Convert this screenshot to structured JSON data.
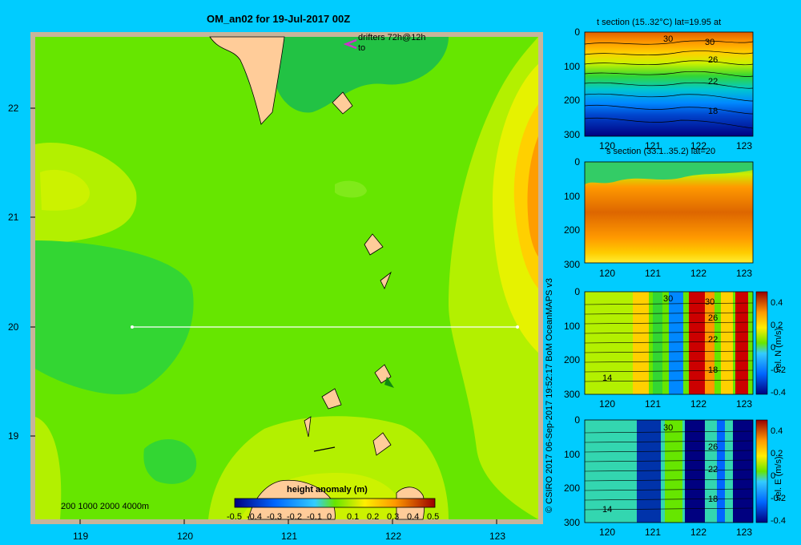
{
  "main": {
    "title": "OM_an02 for 19-Jul-2017 00Z",
    "drifters_label": "drifters 72h@12h",
    "drifters_sub": "to",
    "depth_legend": "200  1000  2000  4000m",
    "lat_ticks": [
      "22",
      "21",
      "20",
      "19"
    ],
    "lon_ticks": [
      "119",
      "120",
      "121",
      "122",
      "123"
    ],
    "section_line": {
      "lat": 20.0,
      "lon_start": 119.5,
      "lon_end": 123.2
    }
  },
  "colorbar": {
    "title": "height anomaly  (m)",
    "ticks": [
      "-0.5",
      "-0.4",
      "-0.3",
      "-0.2",
      "-0.1",
      "0",
      "0.1",
      "0.2",
      "0.3",
      "0.4",
      "0.5"
    ],
    "range": [
      -0.5,
      0.5
    ]
  },
  "credit": "© CSIRO 2017   06-Sep-2017 19:52:17 BoM OceanMAPS v3",
  "panels": [
    {
      "title": "t section (15..32°C) lat=19.95 at",
      "contour_labels": [
        "30",
        "30",
        "26",
        "22",
        "18"
      ]
    },
    {
      "title": "s section (33.1..35.2) lat=20",
      "contour_labels": []
    },
    {
      "title": "",
      "contour_labels": [
        "30",
        "30",
        "26",
        "22",
        "18",
        "14"
      ],
      "cbar_label": "vel. N (m/s)"
    },
    {
      "title": "",
      "contour_labels": [
        "30",
        "26",
        "22",
        "18",
        "14"
      ],
      "cbar_label": "vel. E (m/s)"
    }
  ],
  "panel_depth_ticks": [
    "0",
    "100",
    "200",
    "300"
  ],
  "panel_lon_ticks": [
    "120",
    "121",
    "122",
    "123"
  ],
  "vel_cbar_ticks": [
    "0.4",
    "0.2",
    "0",
    "-0.2",
    "-0.4"
  ],
  "colors": {
    "background": "#00ccff",
    "land": "#ffcc99",
    "section_line": "#ffffff",
    "drifter": "#cc33cc"
  }
}
